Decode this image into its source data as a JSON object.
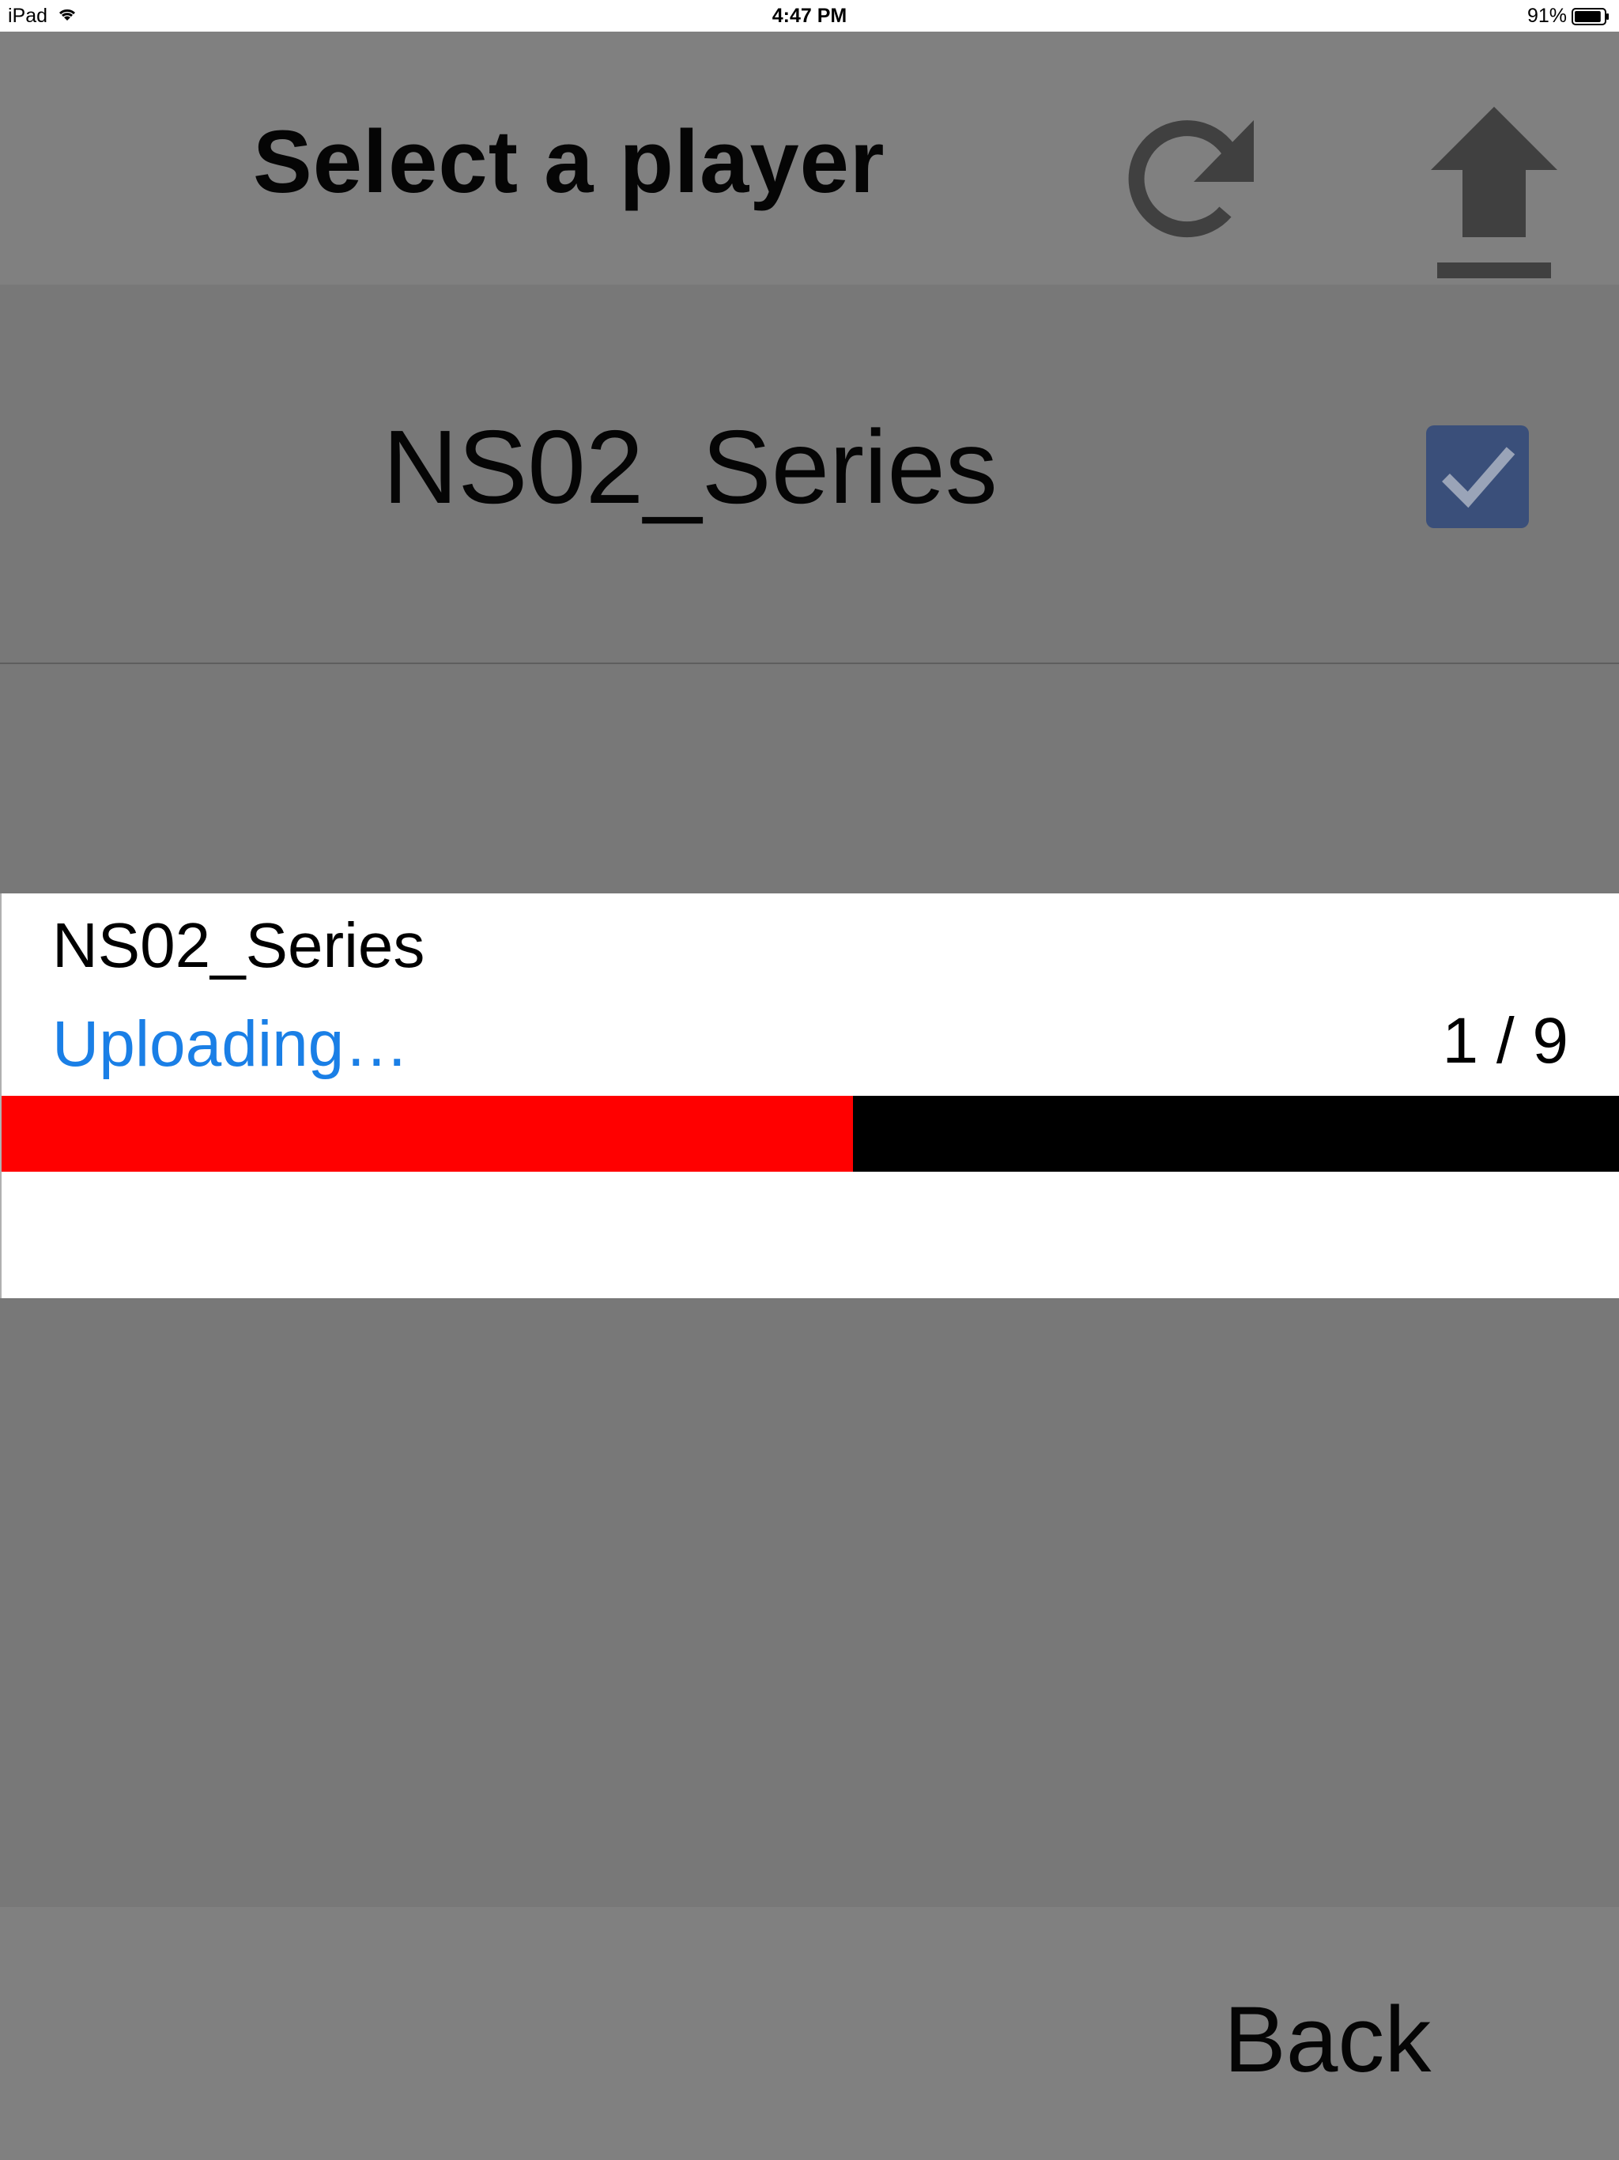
{
  "status_bar": {
    "device": "iPad",
    "time": "4:47 PM",
    "battery": "91%",
    "battery_level": 0.91
  },
  "header": {
    "title": "Select a player",
    "refresh_icon": "refresh-icon",
    "upload_icon": "upload-icon"
  },
  "player_list": {
    "items": [
      {
        "name": "NS02_Series",
        "checked": true
      }
    ]
  },
  "upload_dialog": {
    "player_name": "NS02_Series",
    "status": "Uploading…",
    "count": "1 / 9",
    "progress_fraction": 0.526
  },
  "footer": {
    "back_label": "Back"
  },
  "colors": {
    "progress_fill": "#ff0000",
    "progress_track": "#000000",
    "status_text": "#1a7fe6",
    "checkbox": "#3a4f7a"
  }
}
